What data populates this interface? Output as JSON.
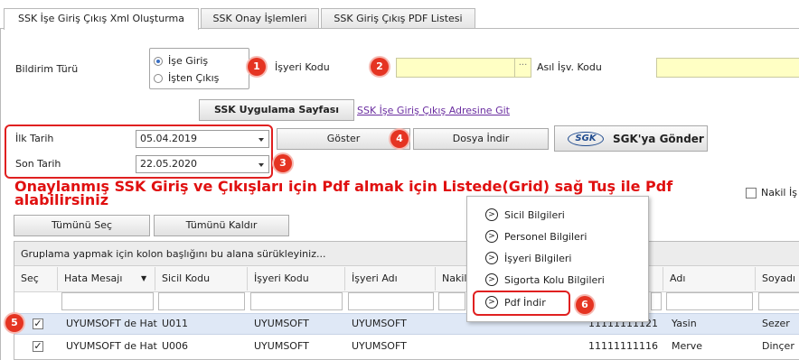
{
  "tabs": [
    "SSK İşe Giriş Çıkış Xml Oluşturma",
    "SSK Onay İşlemleri",
    "SSK Giriş Çıkış PDF Listesi"
  ],
  "form": {
    "bildirim_label": "Bildirim Türü",
    "radio_giris": "İşe Giriş",
    "radio_cikis": "İşten Çıkış",
    "isyeri_kodu_label": "İşyeri Kodu",
    "asil_isv_label": "Asıl İşv. Kodu",
    "dots": "···",
    "ssk_app_button": "SSK Uygulama Sayfası",
    "ssk_link": "SSK İşe Giriş Çıkış Adresine Git",
    "ilk_tarih_label": "İlk Tarih",
    "ilk_tarih_value": "05.04.2019",
    "son_tarih_label": "Son Tarih",
    "son_tarih_value": "22.05.2020",
    "goster_button": "Göster",
    "dosya_indir_button": "Dosya İndir",
    "sgk_logo": "SGK",
    "sgk_send_button": "SGK'ya Gönder",
    "warning": "Onaylanmış SSK Giriş ve Çıkışları için Pdf almak için Listede(Grid) sağ Tuş ile Pdf alabilirsiniz",
    "nakil_label": "Nakil İş",
    "select_all_button": "Tümünü Seç",
    "deselect_all_button": "Tümünü Kaldır"
  },
  "badges": [
    "1",
    "2",
    "3",
    "4",
    "5",
    "6"
  ],
  "grid": {
    "group_hint": "Gruplama yapmak için kolon başlığını bu alana sürükleyiniz...",
    "columns": [
      "Seç",
      "Hata Mesajı",
      "Sicil Kodu",
      "İşyeri Kodu",
      "İşyeri Adı",
      "Nakil",
      "",
      "Adı",
      "Soyadı"
    ],
    "filter_icon": "▼",
    "rows": [
      {
        "checked": "✓",
        "hata": "UYUMSOFT de Hat",
        "sicil": "U011",
        "isyeri_kodu": "UYUMSOFT",
        "isyeri_adi": "UYUMSOFT",
        "tc": "11111111121",
        "adi": "Yasin",
        "soyadi": "Sezer"
      },
      {
        "checked": "✓",
        "hata": "UYUMSOFT de Hat",
        "sicil": "U006",
        "isyeri_kodu": "UYUMSOFT",
        "isyeri_adi": "UYUMSOFT",
        "tc": "11111111116",
        "adi": "Merve",
        "soyadi": "Dinçer"
      }
    ]
  },
  "context_menu": {
    "items": [
      "Sicil Bilgileri",
      "Personel Bilgileri",
      "İşyeri Bilgileri",
      "Sigorta Kolu Bilgileri",
      "Pdf İndir"
    ],
    "icon": ">"
  },
  "colors": {
    "accent_red": "#e53422",
    "highlight_yellow": "#ffffc4",
    "link_purple": "#6a2da0",
    "selected_row": "#dfe8f6"
  }
}
